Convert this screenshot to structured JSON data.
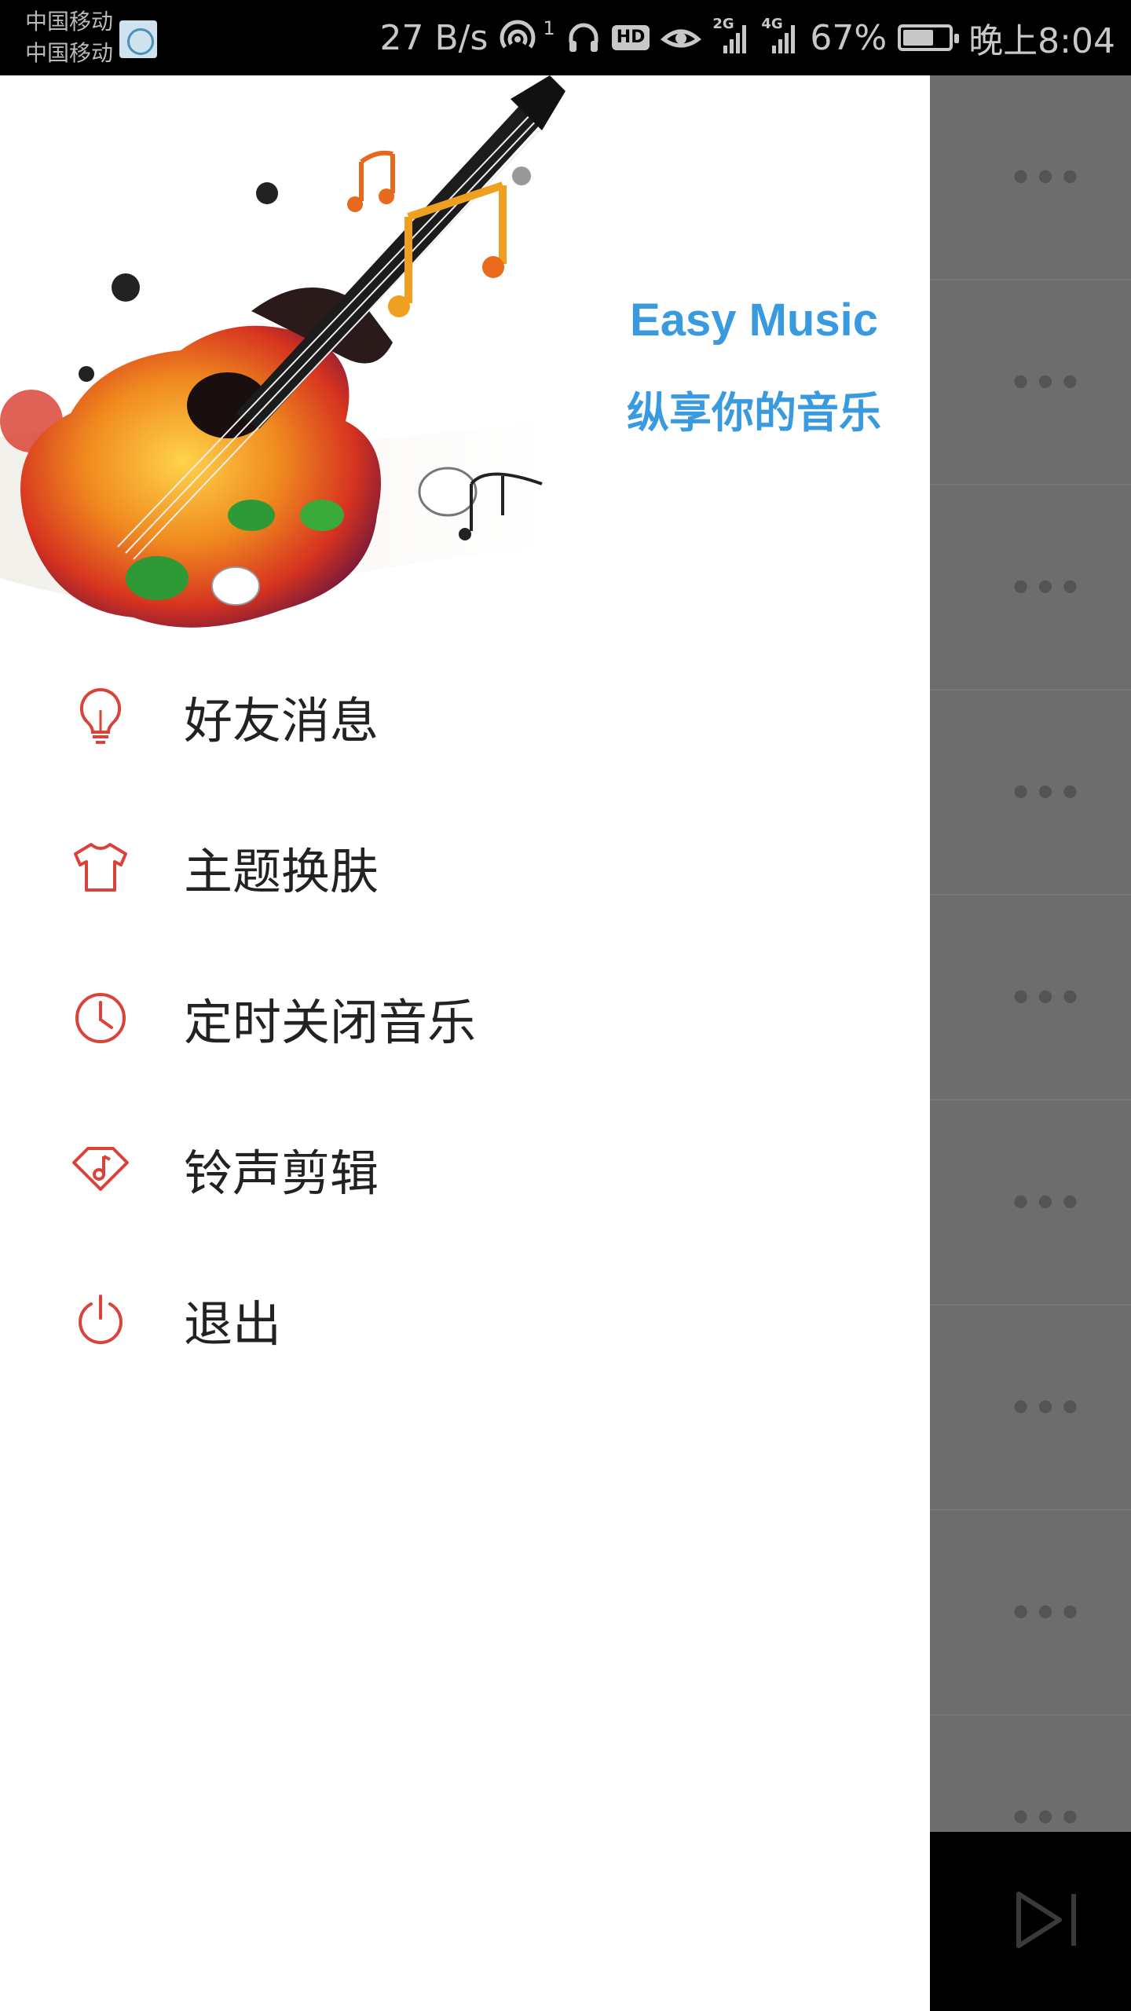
{
  "status_bar": {
    "carrier1": "中国移动",
    "carrier2": "中国移动",
    "net_speed": "27 B/s",
    "hotspot_count": "1",
    "hd_label": "HD",
    "sig1_label": "2G",
    "sig2_label": "4G",
    "battery_pct": "67%",
    "battery_level": 0.67,
    "time": "晚上8:04"
  },
  "drawer": {
    "brand_title": "Easy Music",
    "brand_slogan": "纵享你的音乐",
    "menu": [
      {
        "label": "好友消息",
        "icon": "lightbulb-icon"
      },
      {
        "label": "主题换肤",
        "icon": "tshirt-icon"
      },
      {
        "label": "定时关闭音乐",
        "icon": "clock-icon"
      },
      {
        "label": "铃声剪辑",
        "icon": "ringtone-tag-icon"
      },
      {
        "label": "退出",
        "icon": "power-icon"
      }
    ]
  },
  "background_list": {
    "more_glyph": "•••"
  },
  "colors": {
    "accent": "#d9443a",
    "brand_blue": "#3a9ae0",
    "overlay": "#6d6d6d"
  }
}
